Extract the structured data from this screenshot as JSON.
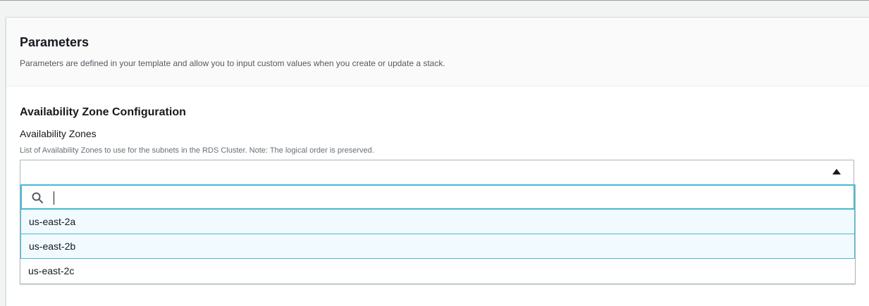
{
  "panel": {
    "title": "Parameters",
    "description": "Parameters are defined in your template and allow you to input custom values when you create or update a stack."
  },
  "section": {
    "title": "Availability Zone Configuration"
  },
  "field": {
    "label": "Availability Zones",
    "description": "List of Availability Zones to use for the subnets in the RDS Cluster. Note: The logical order is preserved.",
    "value": "",
    "search_value": "",
    "search_placeholder": "",
    "options": [
      {
        "label": "us-east-2a",
        "highlighted": true
      },
      {
        "label": "us-east-2b",
        "highlighted": true
      },
      {
        "label": "us-east-2c",
        "highlighted": false
      }
    ]
  },
  "icons": {
    "search": "search-icon",
    "caret": "caret-up-icon"
  },
  "colors": {
    "focus_border": "#44b9d6",
    "highlight_bg": "#f1faff",
    "page_bg": "#f2f3f3"
  }
}
